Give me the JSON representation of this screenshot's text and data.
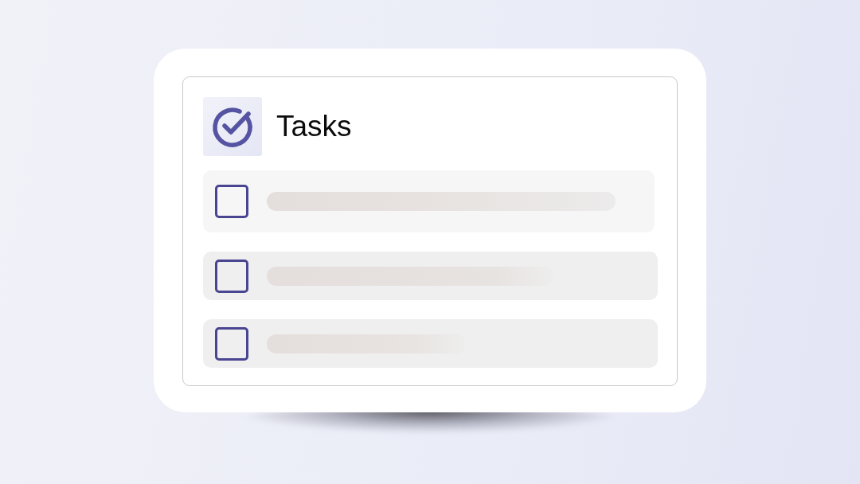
{
  "panel": {
    "title": "Tasks"
  },
  "tasks": [
    {
      "checked": false
    },
    {
      "checked": false
    },
    {
      "checked": false
    }
  ]
}
